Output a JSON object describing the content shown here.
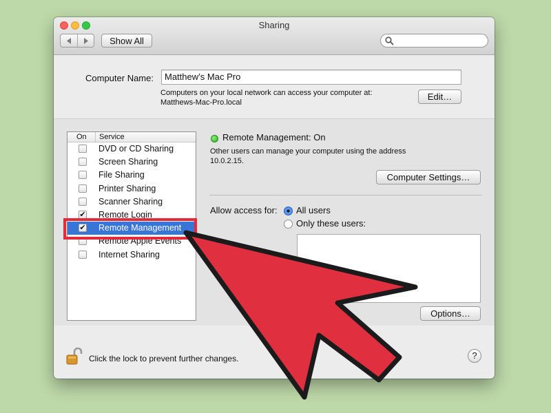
{
  "window": {
    "title": "Sharing"
  },
  "toolbar": {
    "show_all": "Show All",
    "back_icon": "chevron-left-icon",
    "forward_icon": "chevron-right-icon",
    "search_placeholder": ""
  },
  "computer": {
    "name_label": "Computer Name:",
    "name_value": "Matthew’s Mac Pro",
    "info_line1": "Computers on your local network can access your computer at:",
    "info_line2": "Matthews-Mac-Pro.local",
    "edit_label": "Edit…"
  },
  "services": {
    "col_on": "On",
    "col_service": "Service",
    "items": [
      {
        "label": "DVD or CD Sharing",
        "checked": false,
        "selected": false
      },
      {
        "label": "Screen Sharing",
        "checked": false,
        "selected": false
      },
      {
        "label": "File Sharing",
        "checked": false,
        "selected": false
      },
      {
        "label": "Printer Sharing",
        "checked": false,
        "selected": false
      },
      {
        "label": "Scanner Sharing",
        "checked": false,
        "selected": false
      },
      {
        "label": "Remote Login",
        "checked": true,
        "selected": false
      },
      {
        "label": "Remote Management",
        "checked": true,
        "selected": true
      },
      {
        "label": "Remote Apple Events",
        "checked": false,
        "selected": false
      },
      {
        "label": "Internet Sharing",
        "checked": false,
        "selected": false
      }
    ]
  },
  "detail": {
    "status": "Remote Management: On",
    "status_color": "#2bac1f",
    "desc_line1": "Other users can manage your computer using the address",
    "desc_line2": "10.0.2.15.",
    "computer_settings_label": "Computer Settings…",
    "allow_access_label": "Allow access for:",
    "opt_all_users": "All users",
    "opt_only_these": "Only these users:",
    "selected_option": "All users",
    "options_label": "Options…"
  },
  "footer": {
    "lock_text": "Click the lock to prevent further changes.",
    "help_label": "?"
  },
  "annotation": {
    "color": "#e5293b"
  }
}
